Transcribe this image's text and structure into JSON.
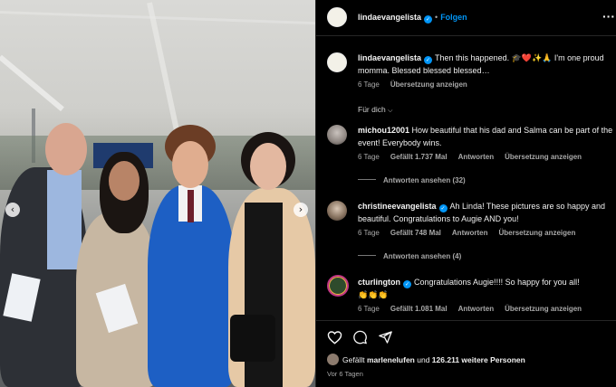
{
  "post": {
    "author": "lindaevangelista",
    "follow_label": "Folgen",
    "caption": "Then this happened. 🎓❤️✨🙏 I'm one proud momma. Blessed blessed blessed…",
    "caption_age": "6 Tage",
    "caption_translate": "Übersetzung anzeigen",
    "filter_label": "Für dich"
  },
  "comments": [
    {
      "user": "michou12001",
      "verified": false,
      "text": "How beautiful that his dad and Salma can be part of the event! Everybody wins.",
      "age": "6 Tage",
      "likes": "Gefällt 1.737 Mal",
      "reply": "Antworten",
      "translate": "Übersetzung anzeigen",
      "replies": "Antworten ansehen (32)"
    },
    {
      "user": "christineevangelista",
      "verified": true,
      "text": "Ah Linda! These pictures are so happy and beautiful. Congratulations to Augie AND you!",
      "age": "6 Tage",
      "likes": "Gefällt 748 Mal",
      "reply": "Antworten",
      "translate": "Übersetzung anzeigen",
      "replies": "Antworten ansehen (4)"
    },
    {
      "user": "cturlington",
      "verified": true,
      "text": "Congratulations Augie!!!! So happy for you all!",
      "emoji_line": "👏👏👏",
      "age": "6 Tage",
      "likes": "Gefällt 1.081 Mal",
      "reply": "Antworten",
      "translate": "Übersetzung anzeigen"
    }
  ],
  "footer": {
    "liked_prefix": "Gefällt",
    "liked_user": "marlenelufen",
    "liked_mid": "und",
    "liked_rest": "126.211 weitere Personen",
    "time_ago": "Vor 6 Tagen"
  },
  "icons": {
    "heart": "heart-icon",
    "comment": "comment-icon",
    "share": "share-icon",
    "verified": "verified-badge-icon",
    "prev": "chevron-left-icon",
    "next": "chevron-right-icon",
    "more": "more-options-icon"
  },
  "colors": {
    "accent": "#0095f6",
    "muted": "#a8a8a8",
    "background": "#000000",
    "gown": "#1d5fc4"
  }
}
